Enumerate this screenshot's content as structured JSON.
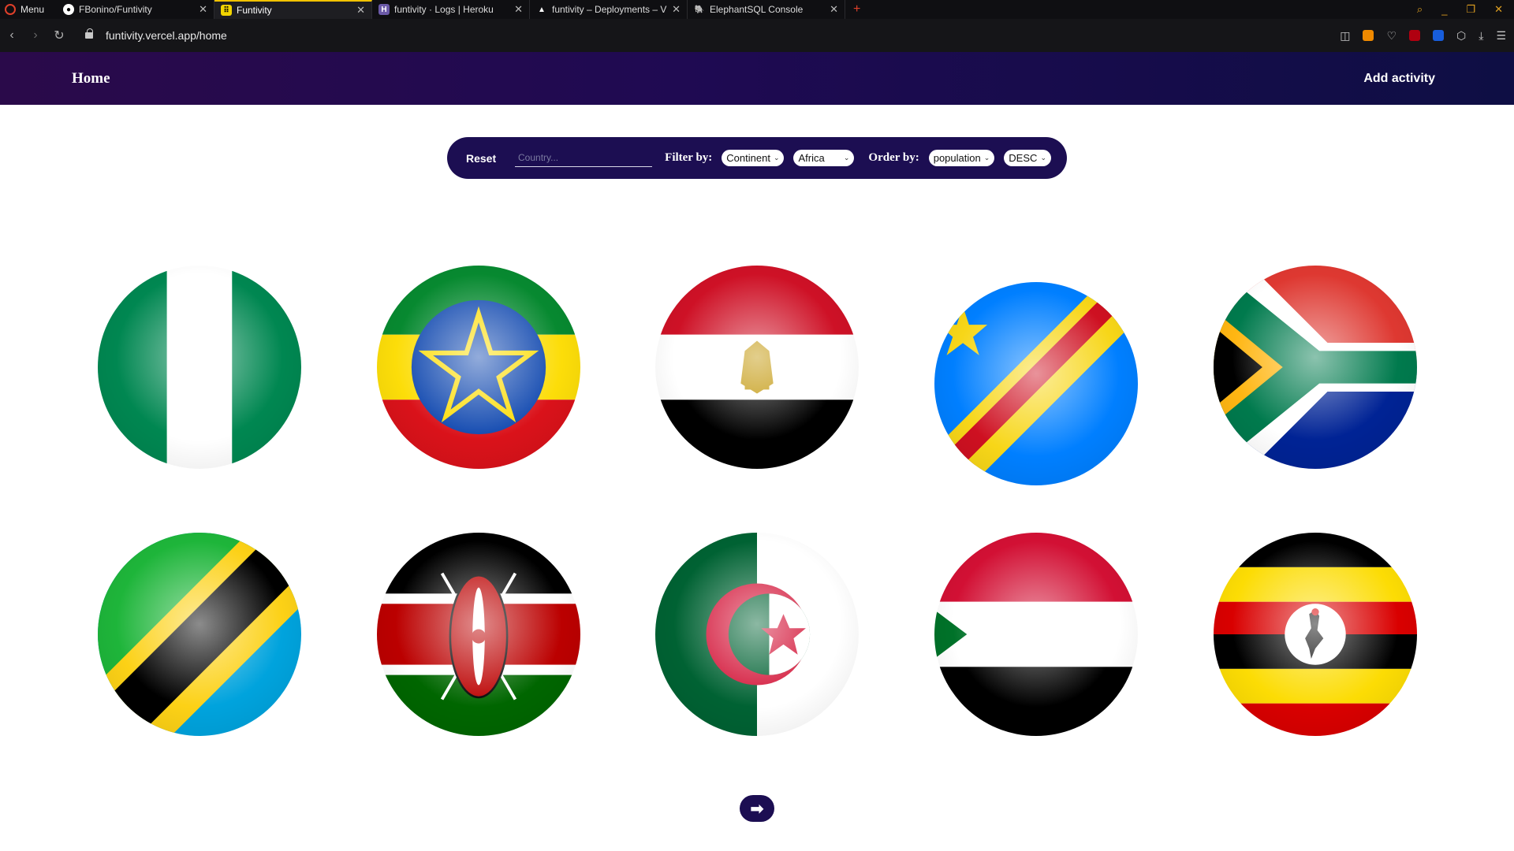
{
  "browser": {
    "menu_label": "Menu",
    "tabs": [
      {
        "label": "FBonino/Funtivity",
        "icon": "github-icon"
      },
      {
        "label": "Funtivity",
        "icon": "funtivity-icon",
        "active": true
      },
      {
        "label": "funtivity · Logs | Heroku",
        "icon": "heroku-icon"
      },
      {
        "label": "funtivity – Deployments – V",
        "icon": "vercel-icon"
      },
      {
        "label": "ElephantSQL Console",
        "icon": "elephant-icon"
      }
    ],
    "url": "funtivity.vercel.app/home"
  },
  "header": {
    "home_label": "Home",
    "add_activity_label": "Add activity"
  },
  "filter_bar": {
    "reset_label": "Reset",
    "search_placeholder": "Country...",
    "filter_label": "Filter by:",
    "filter_type": "Continent",
    "filter_value": "Africa",
    "order_label": "Order by:",
    "order_field": "population",
    "order_direction": "DESC"
  },
  "countries": [
    {
      "flag": "nigeria-flag"
    },
    {
      "flag": "ethiopia-flag"
    },
    {
      "flag": "egypt-flag"
    },
    {
      "flag": "dr-congo-flag"
    },
    {
      "flag": "south-africa-flag"
    },
    {
      "flag": "tanzania-flag"
    },
    {
      "flag": "kenya-flag"
    },
    {
      "flag": "algeria-flag"
    },
    {
      "flag": "sudan-flag"
    },
    {
      "flag": "uganda-flag"
    }
  ],
  "pagination": {
    "next_icon": "arrow-right-icon"
  },
  "colors": {
    "header_start": "#2a0a4a",
    "header_end": "#0e0e44",
    "filter_bg": "#1c0e52"
  }
}
